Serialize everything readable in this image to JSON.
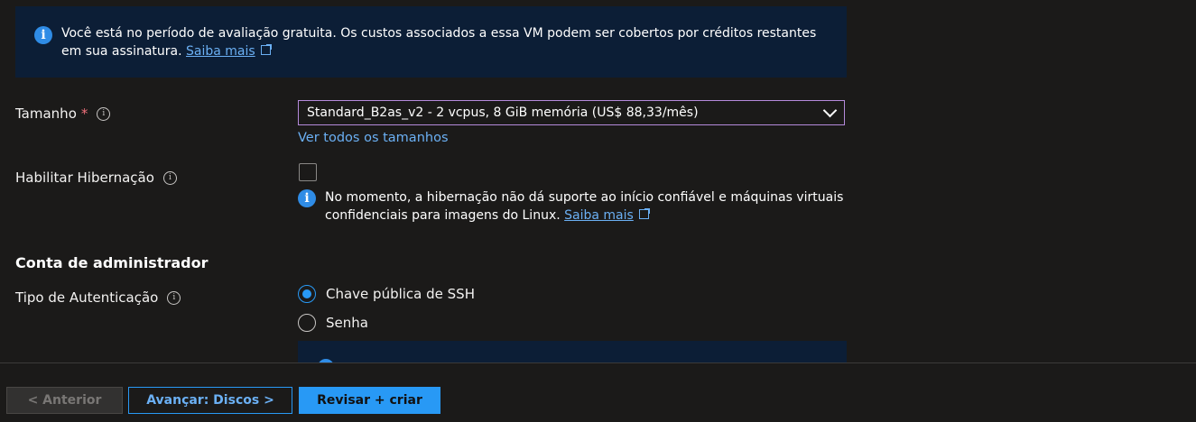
{
  "banner": {
    "text": "Você está no período de avaliação gratuita. Os custos associados a essa VM podem ser cobertos por créditos restantes em sua assinatura.",
    "link": "Saiba mais"
  },
  "size": {
    "label": "Tamanho",
    "required_mark": "*",
    "selected_value": "Standard_B2as_v2 - 2 vcpus, 8 GiB memória (US$ 88,33/mês)",
    "see_all_link": "Ver todos os tamanhos"
  },
  "hibernation": {
    "label": "Habilitar Hibernação",
    "checked": false,
    "info_text": "No momento, a hibernação não dá suporte ao início confiável e máquinas virtuais confidenciais para imagens do Linux.",
    "info_link": "Saiba mais"
  },
  "admin_account": {
    "section_title": "Conta de administrador",
    "auth_type_label": "Tipo de Autenticação",
    "options": [
      {
        "label": "Chave pública de SSH",
        "selected": true
      },
      {
        "label": "Senha",
        "selected": false
      }
    ]
  },
  "footer": {
    "prev_label": "< Anterior",
    "next_label": "Avançar: Discos >",
    "create_label": "Revisar + criar"
  },
  "colors": {
    "background": "#1b1a19",
    "info_banner": "#0c1e36",
    "accent": "#2899f5",
    "link": "#6bb0f4",
    "required": "#f1707b",
    "select_border": "#b58adb"
  }
}
